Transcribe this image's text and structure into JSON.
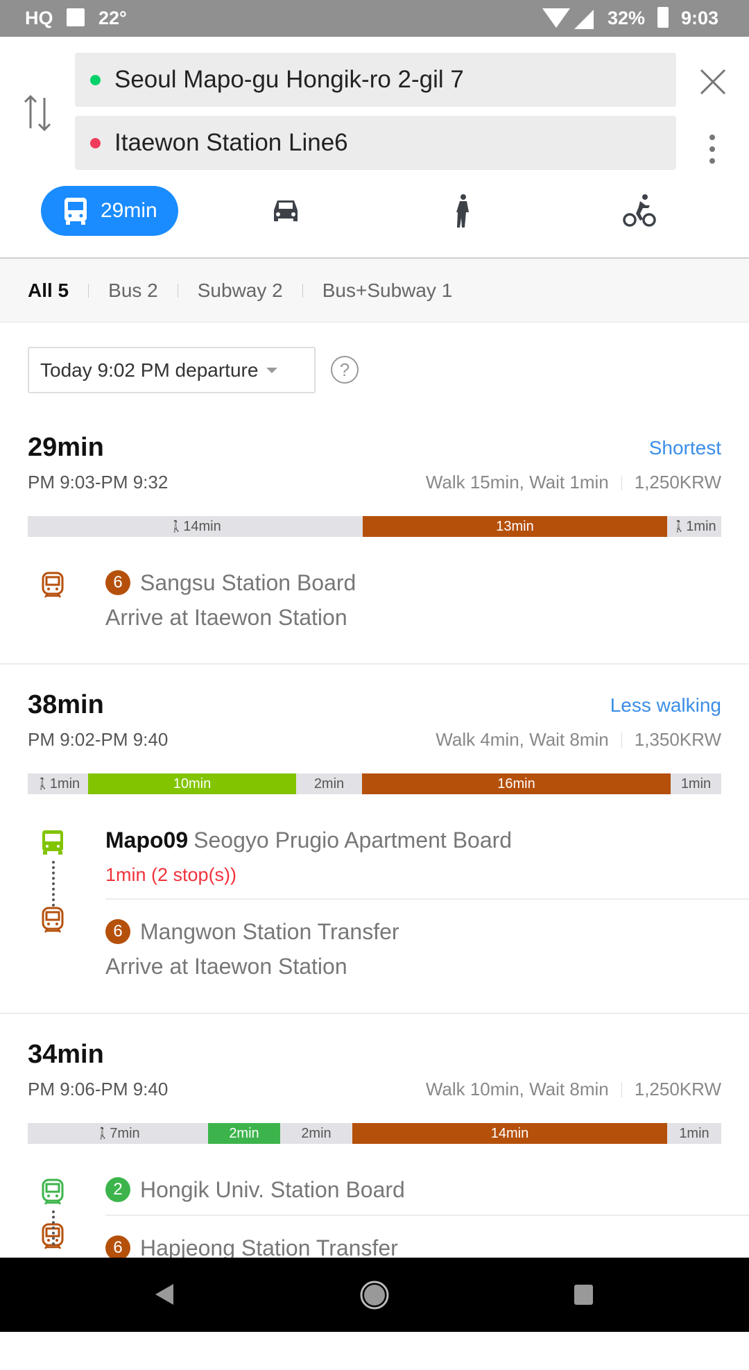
{
  "status_bar": {
    "left_icons": [
      "hq-icon",
      "image-icon"
    ],
    "temperature": "22°",
    "battery": "32%",
    "time": "9:03",
    "right_icons": [
      "wifi-icon",
      "signal-icon",
      "battery-icon"
    ]
  },
  "search": {
    "origin": "Seoul Mapo-gu Hongik-ro 2-gil 7",
    "destination": "Itaewon Station Line6",
    "origin_color": "#00d26a",
    "destination_color": "#f03c5a"
  },
  "modes": {
    "transit_label": "29min",
    "active": "transit",
    "accent": "#1a8cff"
  },
  "filters": [
    "All 5",
    "Bus 2",
    "Subway 2",
    "Bus+Subway 1"
  ],
  "departure": {
    "label": "Today 9:02 PM departure"
  },
  "help_label": "?",
  "colors": {
    "line6": "#b5500b",
    "line2": "#3cb44b",
    "bus_green": "#82c400",
    "walk": "#e2e2e6",
    "red": "#f0323c"
  },
  "routes": [
    {
      "duration": "29min",
      "tag": "Shortest",
      "time": "PM 9:03-PM 9:32",
      "meta": "Walk 15min, Wait 1min",
      "fare": "1,250KRW",
      "segments": [
        {
          "type": "walk",
          "label": "14min"
        },
        {
          "type": "line6",
          "label": "13min"
        },
        {
          "type": "walk",
          "label": "1min"
        }
      ],
      "steps": [
        {
          "icon": "subway",
          "color": "line6",
          "badge": "6",
          "bold": "",
          "text": "Sangsu Station Board",
          "sub": "Arrive at Itaewon Station",
          "sub_red": false
        }
      ]
    },
    {
      "duration": "38min",
      "tag": "Less walking",
      "time": "PM 9:02-PM 9:40",
      "meta": "Walk 4min, Wait 8min",
      "fare": "1,350KRW",
      "segments": [
        {
          "type": "walk",
          "label": "1min"
        },
        {
          "type": "bus_green",
          "label": "10min"
        },
        {
          "type": "gap",
          "label": "2min"
        },
        {
          "type": "line6",
          "label": "16min"
        },
        {
          "type": "gap",
          "label": "1min"
        }
      ],
      "steps": [
        {
          "icon": "bus",
          "color": "bus_green",
          "badge": "",
          "bold": "Mapo09",
          "text": "Seogyo Prugio Apartment Board",
          "sub": "1min (2 stop(s))",
          "sub_red": true
        },
        {
          "icon": "subway",
          "color": "line6",
          "badge": "6",
          "bold": "",
          "text": "Mangwon Station Transfer",
          "sub": "Arrive at Itaewon Station",
          "sub_red": false
        }
      ]
    },
    {
      "duration": "34min",
      "tag": "",
      "time": "PM 9:06-PM 9:40",
      "meta": "Walk 10min, Wait 8min",
      "fare": "1,250KRW",
      "segments": [
        {
          "type": "walk",
          "label": "7min"
        },
        {
          "type": "line2",
          "label": "2min"
        },
        {
          "type": "gap",
          "label": "2min"
        },
        {
          "type": "line6",
          "label": "14min"
        },
        {
          "type": "gap",
          "label": "1min"
        }
      ],
      "steps": [
        {
          "icon": "subway",
          "color": "line2",
          "badge": "2",
          "bold": "",
          "text": "Hongik Univ. Station Board",
          "sub": "",
          "sub_red": false
        },
        {
          "icon": "subway",
          "color": "line6",
          "badge": "6",
          "bold": "",
          "text": "Hapjeong Station Transfer",
          "sub": "",
          "sub_red": false
        }
      ]
    }
  ]
}
